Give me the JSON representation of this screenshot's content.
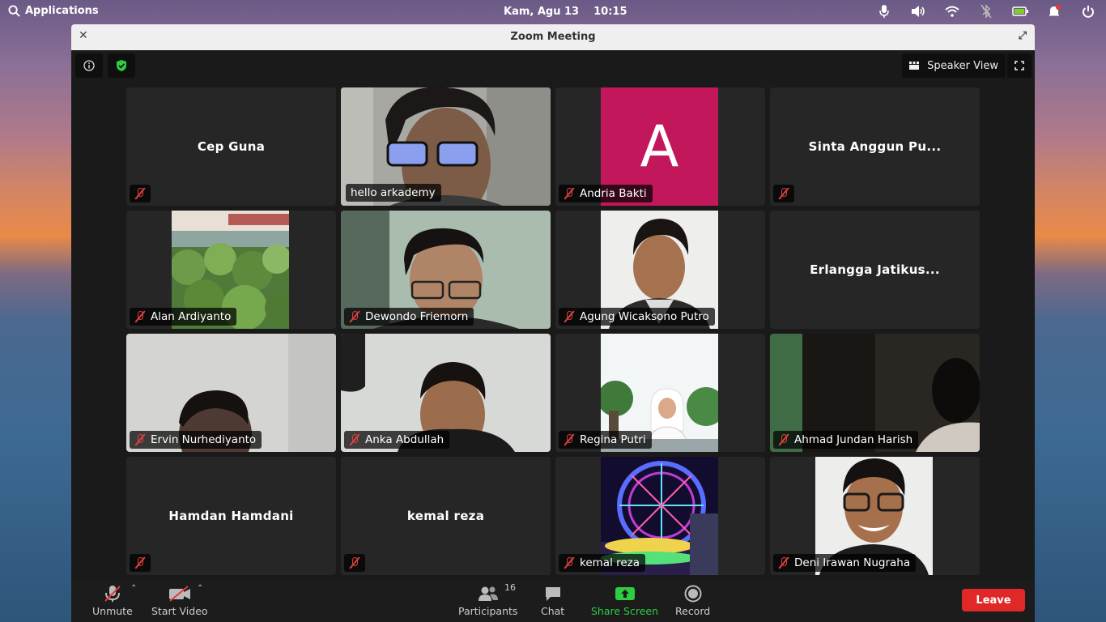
{
  "system": {
    "apps_label": "Applications",
    "date": "Kam, Agu 13",
    "time": "10:15"
  },
  "window": {
    "title": "Zoom Meeting"
  },
  "top": {
    "view_label": "Speaker View"
  },
  "tiles": [
    {
      "name": "Cep Guna"
    },
    {
      "name": "hello arkademy"
    },
    {
      "name": "Andria Bakti",
      "avatar_letter": "A"
    },
    {
      "name": "Sinta Anggun Pu..."
    },
    {
      "name": "Alan Ardiyanto"
    },
    {
      "name": "Dewondo Friemorn"
    },
    {
      "name": "Agung Wicaksono Putro"
    },
    {
      "name": "Erlangga Jatikus..."
    },
    {
      "name": "Ervin Nurhediyanto"
    },
    {
      "name": "Anka Abdullah"
    },
    {
      "name": "Regina Putri"
    },
    {
      "name": "Ahmad Jundan Harish"
    },
    {
      "name": "Hamdan Hamdani"
    },
    {
      "name": "kemal reza"
    },
    {
      "name": "kemal reza"
    },
    {
      "name": "Deni Irawan Nugraha"
    }
  ],
  "toolbar": {
    "unmute": "Unmute",
    "start_video": "Start Video",
    "participants": "Participants",
    "participants_count": "16",
    "chat": "Chat",
    "share": "Share Screen",
    "record": "Record",
    "leave": "Leave"
  },
  "colors": {
    "accent_green": "#2ecc40",
    "leave_red": "#e02828",
    "avatar_bg": "#c2185b"
  }
}
